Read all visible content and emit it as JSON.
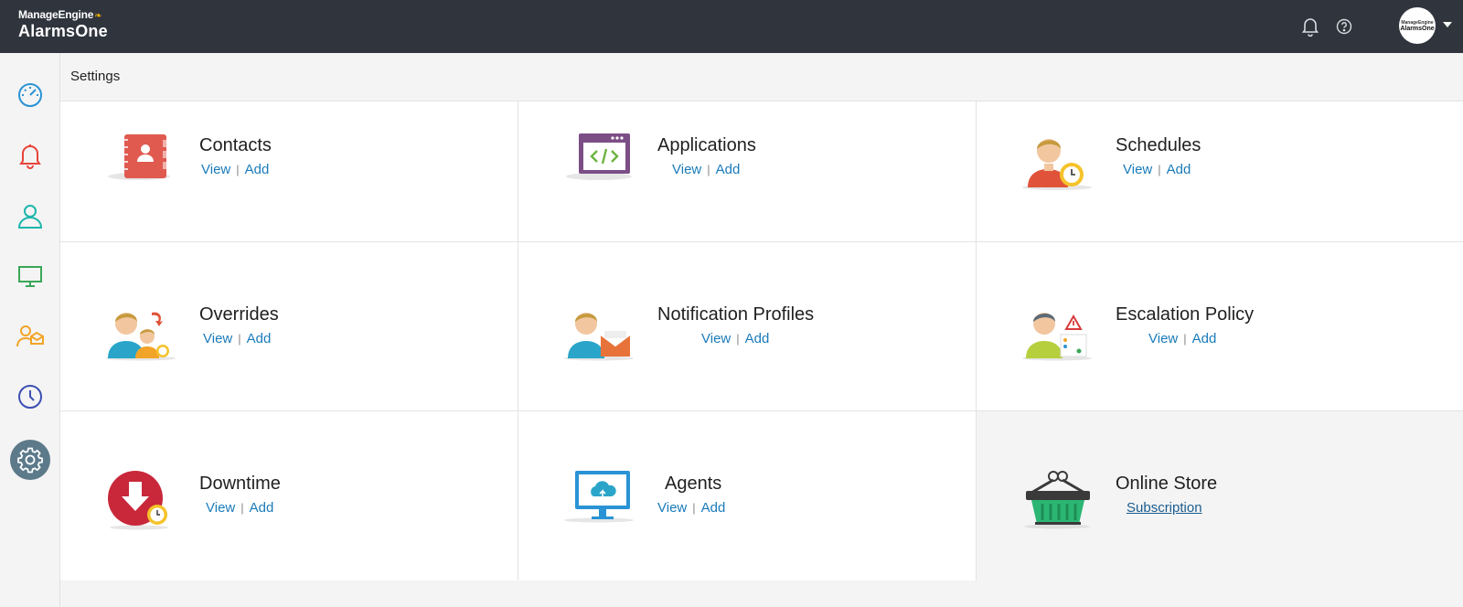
{
  "brand": {
    "company": "ManageEngine",
    "product": "AlarmsOne"
  },
  "header": {
    "avatar_line1": "ManageEngine",
    "avatar_line2": "AlarmsOne"
  },
  "breadcrumb": "Settings",
  "sidebar": {
    "items": [
      {
        "name": "dashboard",
        "icon": "speedometer-icon",
        "color": "#2a93d5"
      },
      {
        "name": "alarms",
        "icon": "bell-icon",
        "color": "#e8433a"
      },
      {
        "name": "contacts",
        "icon": "user-icon",
        "color": "#1db6ac"
      },
      {
        "name": "monitors",
        "icon": "monitor-icon",
        "color": "#3aa757"
      },
      {
        "name": "on-call",
        "icon": "user-mail-icon",
        "color": "#f2a428"
      },
      {
        "name": "schedules",
        "icon": "clock-icon",
        "color": "#3b4fb3"
      },
      {
        "name": "settings",
        "icon": "gear-icon",
        "color": "#ffffff",
        "active": true
      }
    ]
  },
  "cards": [
    {
      "title": "Contacts",
      "view": "View",
      "add": "Add",
      "icon": "contact-book-icon"
    },
    {
      "title": "Applications",
      "view": "View",
      "add": "Add",
      "icon": "code-window-icon"
    },
    {
      "title": "Schedules",
      "view": "View",
      "add": "Add",
      "icon": "user-schedule-icon"
    },
    {
      "title": "Overrides",
      "view": "View",
      "add": "Add",
      "icon": "user-override-icon"
    },
    {
      "title": "Notification Profiles",
      "view": "View",
      "add": "Add",
      "icon": "user-notification-icon"
    },
    {
      "title": "Escalation Policy",
      "view": "View",
      "add": "Add",
      "icon": "user-escalation-icon"
    },
    {
      "title": "Downtime",
      "view": "View",
      "add": "Add",
      "icon": "downtime-icon"
    },
    {
      "title": "Agents",
      "view": "View",
      "add": "Add",
      "icon": "agent-monitor-icon"
    },
    {
      "title": "Online Store",
      "link": "Subscription",
      "icon": "basket-icon"
    }
  ]
}
